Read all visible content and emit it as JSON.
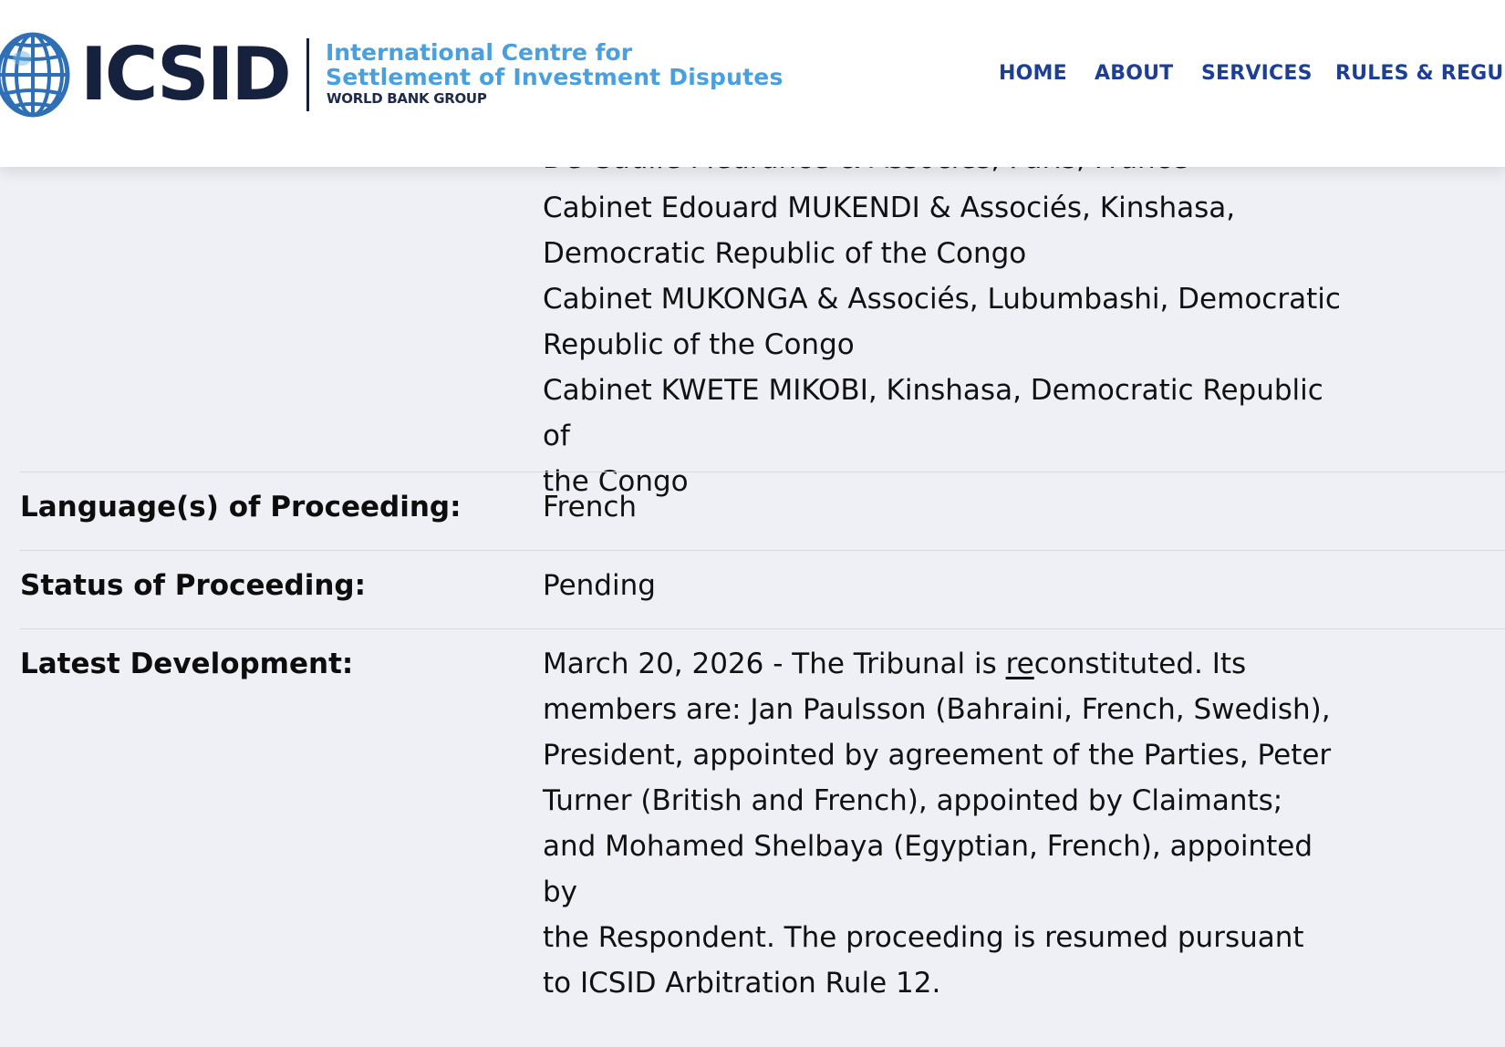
{
  "header": {
    "logo_text": "ICSID",
    "org_line1": "International Centre for",
    "org_line2": "Settlement of Investment Disputes",
    "org_group": "WORLD BANK GROUP",
    "nav": [
      "HOME",
      "ABOUT",
      "SERVICES",
      "RULES & REGUL"
    ]
  },
  "content": {
    "cut_off_line": "De Gaulle Fleurance & Associés, Paris, France",
    "counsel_lines": [
      "Cabinet Edouard MUKENDI & Associés, Kinshasa,",
      "Democratic Republic of the Congo",
      "Cabinet MUKONGA & Associés, Lubumbashi, Democratic",
      "Republic of the Congo",
      "Cabinet KWETE MIKOBI, Kinshasa, Democratic Republic of",
      "the Congo"
    ],
    "language": {
      "label": "Language(s) of Proceeding:",
      "value": "French"
    },
    "status": {
      "label": "Status of Proceeding:",
      "value": "Pending"
    },
    "latest": {
      "label": "Latest Development:",
      "line1_before": "March 20, 2026 - The Tribunal is ",
      "line1_underlined": "re",
      "line1_after": "constituted. Its",
      "lines": [
        "members are: Jan Paulsson (Bahraini, French, Swedish),",
        "President, appointed by agreement of the Parties, Peter",
        "Turner (British and French), appointed by Claimants;",
        "and Mohamed Shelbaya (Egyptian, French), appointed by",
        "the Respondent. The proceeding is resumed pursuant",
        "to ICSID Arbitration Rule 12."
      ]
    }
  },
  "colors": {
    "nav": "#1c3f94",
    "logo_dark": "#16213e",
    "logo_light": "#4a9fde",
    "background": "#eff0f5"
  }
}
